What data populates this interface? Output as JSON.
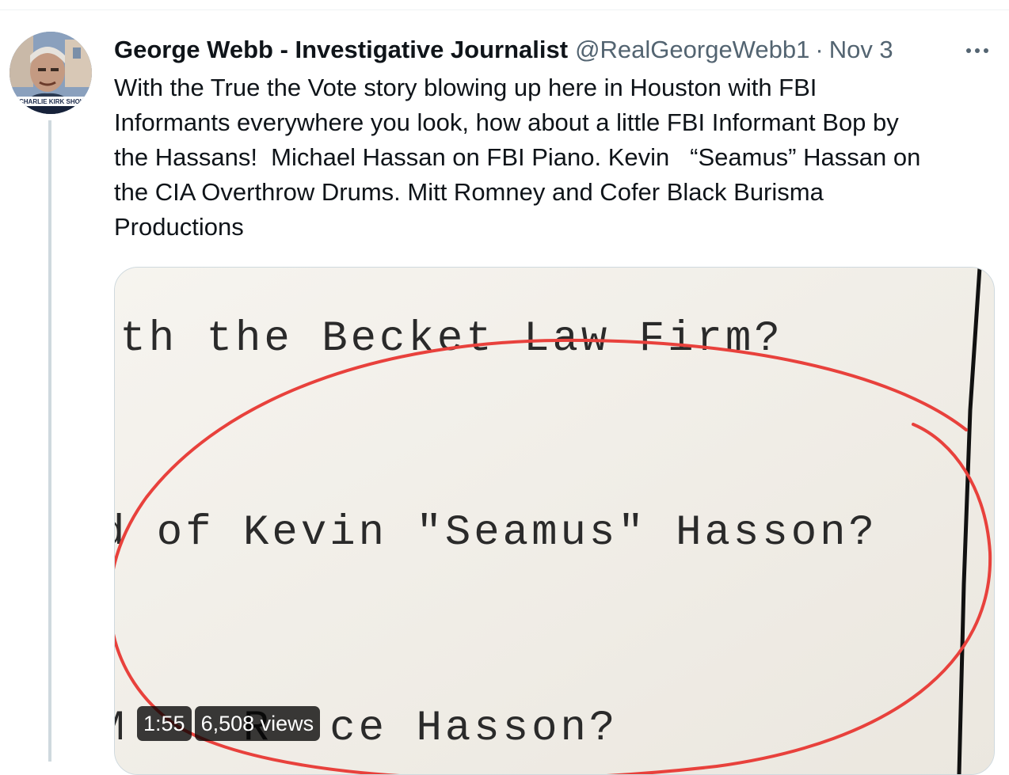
{
  "tweet": {
    "author_name": "George Webb - Investigative Journalist",
    "handle": "@RealGeorgeWebb1",
    "separator": "·",
    "date": "Nov 3",
    "avatar_banner_text": "CHARLIE KIRK SHOW",
    "text_lines": [
      "With the True the Vote story blowing up here in Houston with FBI",
      "Informants everywhere you look, how about a little FBI Informant Bop by",
      "the Hassans!  Michael Hassan on FBI Piano. Kevin   “Seamus” Hassan on",
      "the CIA Overthrow Drums. Mitt Romney and Cofer Black Burisma",
      "Productions"
    ]
  },
  "media": {
    "typed_lines": [
      "ith the Becket Law Firm?",
      "d of Kevin \"Seamus\" Hasson?",
      "M    R  ce Hasson?"
    ],
    "duration": "1:55",
    "views": "6,508 views",
    "annotation_color": "#e8413c"
  },
  "colors": {
    "text_primary": "#0f1419",
    "text_secondary": "#536471",
    "border": "#cfd9de"
  }
}
